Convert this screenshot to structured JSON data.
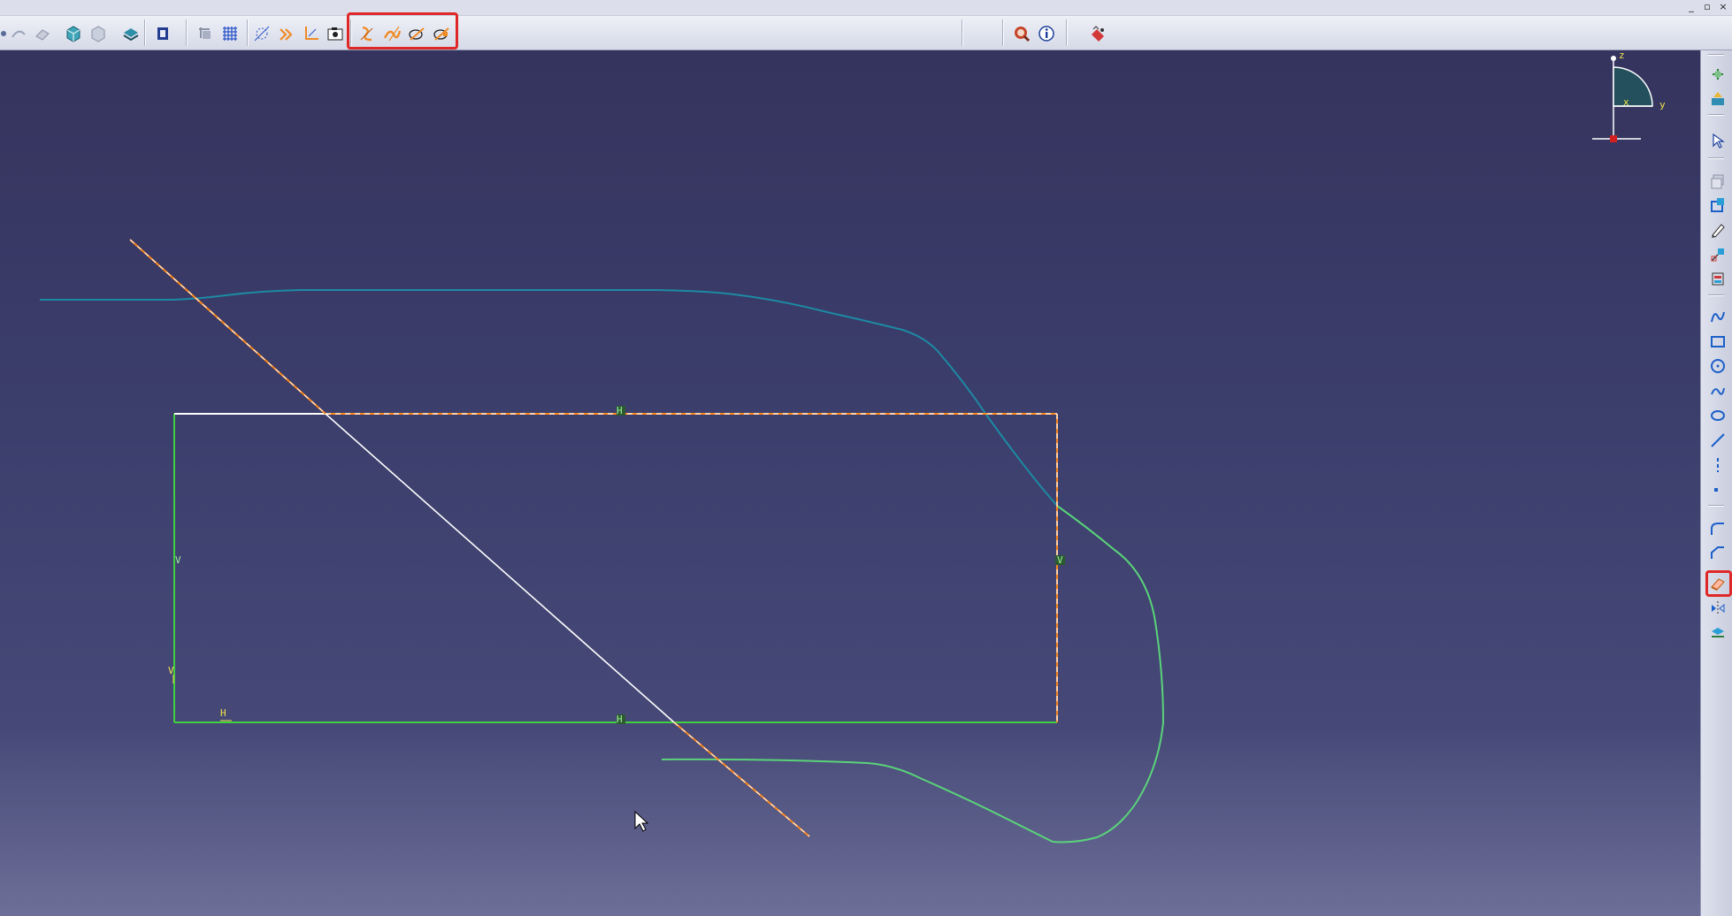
{
  "window": {
    "controls": {
      "minimize": "_",
      "restore": "▫",
      "close": "×"
    }
  },
  "toolbar_top": {
    "icons": [
      "shading-icon",
      "undo-arc-icon",
      "shape-icon",
      "view-part-icon",
      "view-part2-icon",
      "render-style-icon",
      "normal-view-icon",
      "sketch-grid-icon",
      "snap-grid-icon",
      "cut-part-icon",
      "geometry-icon",
      "axis-icon",
      "image-capture-icon",
      "sketch-constraint-icon",
      "sketch-trim-icon",
      "sketch-quick-trim-icon",
      "sketch-break-icon",
      "query-icon",
      "info-icon",
      "analysis-icon"
    ],
    "highlight_color": "#e02727"
  },
  "toolbar_right": {
    "icons": [
      "exit-workbench-icon",
      "export-icon",
      "select-arrow-icon",
      "copy-icon",
      "profile-icon",
      "pencil-icon",
      "constraint-icon",
      "insert-icon",
      "spline-icon",
      "rectangle-icon",
      "circle-icon",
      "curve-icon",
      "ellipse-icon",
      "line-icon",
      "axis-line-icon",
      "point-icon",
      "corner-icon",
      "chamfer-icon",
      "trim-eraser-icon",
      "mirror-icon",
      "project-icon"
    ],
    "highlighted": "trim-eraser-icon"
  },
  "compass": {
    "z": "z",
    "y": "y",
    "x": "x"
  },
  "constraints": {
    "top_h": "H",
    "bottom_h": "H",
    "left_v": "V",
    "right_v": "V",
    "corner_h": "H",
    "corner_v": "V"
  },
  "colors": {
    "background_top": "#35345e",
    "background_bottom": "#6d6f98",
    "sketch_green": "#3fd23f",
    "profile_teal": "#1d8aa3",
    "curve_light_green": "#5ad37a",
    "construction_orange": "#ff8a1e",
    "selection_white": "#ffffff"
  }
}
